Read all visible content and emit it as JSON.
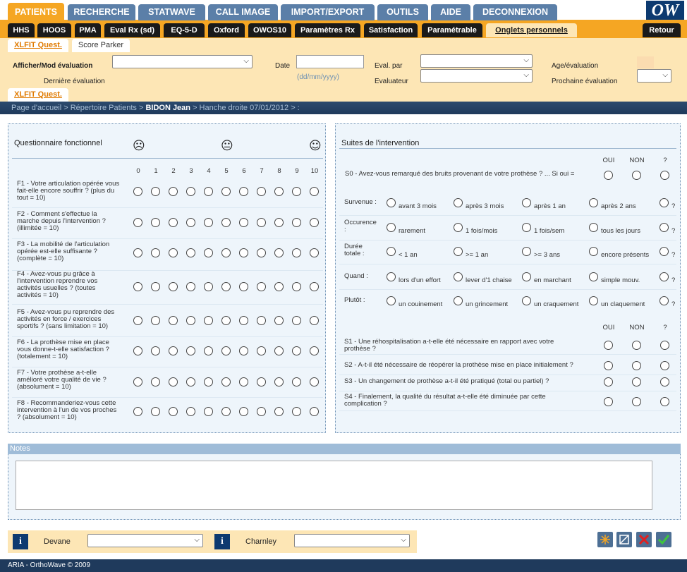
{
  "top_tabs": [
    "PATIENTS",
    "RECHERCHE",
    "STATWAVE",
    "CALL IMAGE",
    "IMPORT/EXPORT",
    "OUTILS",
    "AIDE",
    "DECONNEXION"
  ],
  "logo": "OW",
  "sub_tabs": [
    "HHS",
    "HOOS",
    "PMA",
    "Eval Rx (sd)",
    "EQ-5-D",
    "Oxford",
    "OWOS10",
    "Paramètres Rx",
    "Satisfaction",
    "Paramétrable",
    "Onglets personnels"
  ],
  "retour": "Retour",
  "form_tabs": [
    "XLFIT Quest.",
    "Score Parker"
  ],
  "form": {
    "afficher_label": "Afficher/Mod évaluation",
    "derniere_label": "Dernière évaluation",
    "date_label": "Date",
    "date_format": "(dd/mm/yyyy)",
    "eval_par_label": "Eval. par",
    "evaluateur_label": "Evaluateur",
    "age_label": "Age/évaluation",
    "prochaine_label": "Prochaine évaluation",
    "sub_tab": "XLFIT Quest."
  },
  "breadcrumb": {
    "pre": "Page d'accueil > Répertoire Patients > ",
    "patient": "BIDON Jean",
    "post": " > Hanche droite 07/01/2012 > :"
  },
  "left": {
    "title": "Questionnaire fonctionnel",
    "scale": [
      "0",
      "1",
      "2",
      "3",
      "4",
      "5",
      "6",
      "7",
      "8",
      "9",
      "10"
    ],
    "questions": [
      [
        "F1 - Votre articulation opérée vous",
        "fait-elle encore souffrir ? (plus du",
        "tout = 10)"
      ],
      [
        "F2 - Comment s'effectue la",
        "marche depuis l'intervention ?",
        "(illimitée = 10)"
      ],
      [
        "F3 - La mobilité de l'articulation",
        "opérée est-elle suffisante ?",
        "(complète = 10)"
      ],
      [
        "F4 - Avez-vous pu grâce à",
        "l'intervention reprendre vos",
        "activités usuelles ? (toutes",
        "activités = 10)"
      ],
      [
        "F5 - Avez-vous pu reprendre des",
        "activités en force / exercices",
        "sportifs ? (sans limitation = 10)"
      ],
      [
        "F6 - La prothèse mise en place",
        "vous donne-t-elle satisfaction ?",
        "(totalement = 10)"
      ],
      [
        "F7 - Votre prothèse a-t-elle",
        "amélioré votre qualité de vie ?",
        "(absolument = 10)"
      ],
      [
        "F8 - Recommanderiez-vous cette",
        "intervention à l'un de vos proches",
        "? (absolument = 10)"
      ]
    ]
  },
  "right": {
    "title": "Suites de l'intervention",
    "yn": [
      "OUI",
      "NON",
      "?"
    ],
    "s0": "S0 - Avez-vous remarqué des bruits provenant de votre prothèse ? ... Si oui =",
    "groups": [
      {
        "label": [
          "Survenue :"
        ],
        "options": [
          "avant 3 mois",
          "après 3 mois",
          "après 1 an",
          "après 2 ans",
          "?"
        ]
      },
      {
        "label": [
          "Occurence",
          ":"
        ],
        "options": [
          "rarement",
          "1 fois/mois",
          "1 fois/sem",
          "tous les jours",
          "?"
        ]
      },
      {
        "label": [
          "Durée",
          "totale :"
        ],
        "options": [
          "< 1 an",
          ">= 1 an",
          ">= 3 ans",
          "encore présents",
          "?"
        ]
      },
      {
        "label": [
          "Quand :"
        ],
        "options": [
          "lors d'un effort",
          "lever d'1 chaise",
          "en marchant",
          "simple mouv.",
          "?"
        ]
      },
      {
        "label": [
          "Plutôt :"
        ],
        "options": [
          "un couinement",
          "un grincement",
          "un craquement",
          "un claquement",
          "?"
        ]
      }
    ],
    "sq": [
      [
        "S1 - Une réhospitalisation a-t-elle été nécessaire en rapport avec votre",
        "prothèse ?"
      ],
      [
        "S2 - A-t-il été nécessaire de réopérer la prothèse mise en place initialement ?"
      ],
      [
        "S3 - Un changement de prothèse a-t-il été pratiqué (total ou partiel) ?"
      ],
      [
        "S4 - Finalement, la qualité du résultat a-t-elle été diminuée par cette",
        "complication ?"
      ]
    ]
  },
  "notes_title": "Notes",
  "bottom": {
    "devane": "Devane",
    "charnley": "Charnley"
  },
  "footer": "ARIA - OrthoWave © 2009"
}
